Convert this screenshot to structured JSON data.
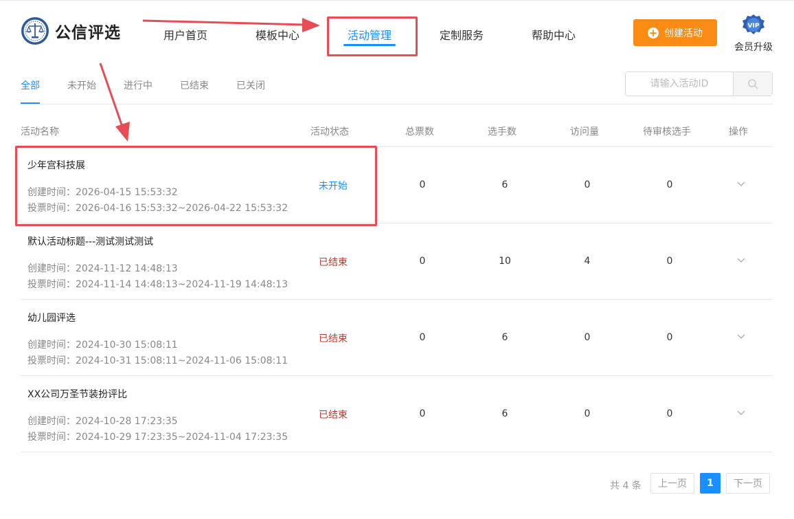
{
  "brand": {
    "name": "公信评选"
  },
  "nav": [
    {
      "label": "用户首页"
    },
    {
      "label": "模板中心"
    },
    {
      "label": "活动管理",
      "active": true
    },
    {
      "label": "定制服务"
    },
    {
      "label": "帮助中心"
    }
  ],
  "header": {
    "create_label": "创建活动",
    "vip_badge": "VIP",
    "vip_label": "会员升级"
  },
  "tabs": [
    {
      "label": "全部",
      "active": true
    },
    {
      "label": "未开始"
    },
    {
      "label": "进行中"
    },
    {
      "label": "已结束"
    },
    {
      "label": "已关闭"
    }
  ],
  "search": {
    "placeholder": "请输入活动ID"
  },
  "table": {
    "columns": [
      "活动名称",
      "活动状态",
      "总票数",
      "选手数",
      "访问量",
      "待审核选手",
      "操作"
    ],
    "rows": [
      {
        "name": "少年宫科技展",
        "created": "创建时间：2026-04-15 15:53:32",
        "vote_period": "投票时间：2026-04-16 15:53:32~2026-04-22 15:53:32",
        "status": "未开始",
        "total_votes": "0",
        "contestants": "6",
        "visits": "0",
        "pending": "0"
      },
      {
        "name": "默认活动标题---测试测试测试",
        "created": "创建时间：2024-11-12 14:48:13",
        "vote_period": "投票时间：2024-11-14 14:48:13~2024-11-19 14:48:13",
        "status": "已结束",
        "total_votes": "0",
        "contestants": "10",
        "visits": "4",
        "pending": "0"
      },
      {
        "name": "幼儿园评选",
        "created": "创建时间：2024-10-30 15:08:11",
        "vote_period": "投票时间：2024-10-31 15:08:11~2024-11-06 15:08:11",
        "status": "已结束",
        "total_votes": "0",
        "contestants": "6",
        "visits": "0",
        "pending": "0"
      },
      {
        "name": "XX公司万圣节装扮评比",
        "created": "创建时间：2024-10-28 17:23:35",
        "vote_period": "投票时间：2024-10-29 17:23:35~2024-11-04 17:23:35",
        "status": "已结束",
        "total_votes": "0",
        "contestants": "6",
        "visits": "0",
        "pending": "0"
      }
    ]
  },
  "pagination": {
    "total": "共 4 条",
    "prev": "上一页",
    "current": "1",
    "next": "下一页"
  },
  "colors": {
    "accent": "#1890ff",
    "create_button": "#fa8c16",
    "ended_status": "#c0392b",
    "annotation": "#e74c54"
  }
}
